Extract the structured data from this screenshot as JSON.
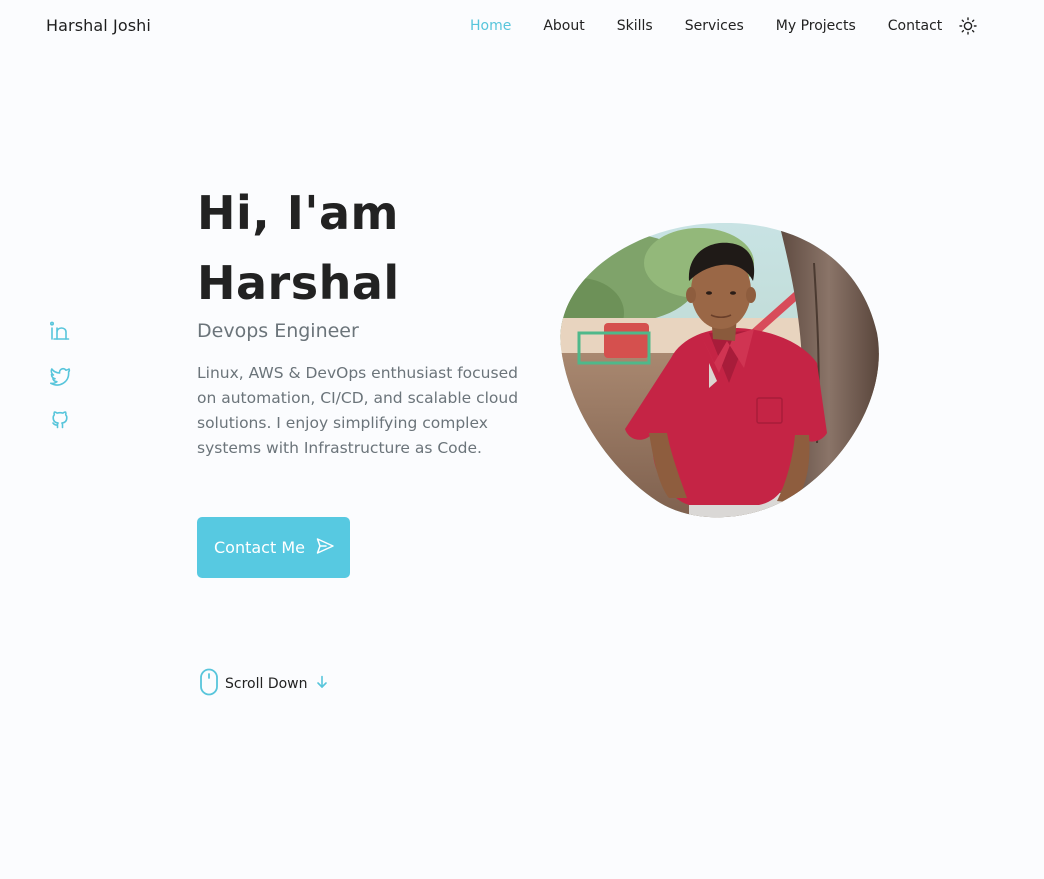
{
  "header": {
    "logo": "Harshal Joshi",
    "nav": {
      "home": "Home",
      "about": "About",
      "skills": "Skills",
      "services": "Services",
      "projects": "My Projects",
      "contact": "Contact"
    },
    "theme_icon": "sun-icon"
  },
  "social": {
    "icons": [
      "linkedin-icon",
      "twitter-icon",
      "github-icon"
    ]
  },
  "hero": {
    "greeting": "Hi, I'am",
    "name": "Harshal",
    "subtitle": "Devops Engineer",
    "description": "Linux, AWS & DevOps enthusiast focused on automation, CI/CD, and scalable cloud solutions. I enjoy simplifying complex systems with Infrastructure as Code.",
    "contact_button": "Contact Me",
    "contact_icon": "send-icon"
  },
  "scroll": {
    "label": "Scroll Down",
    "mouse_icon": "mouse-icon",
    "arrow_icon": "arrow-down-icon"
  },
  "colors": {
    "accent": "#57c5db",
    "button": "#57c9e1",
    "text": "#222222",
    "muted": "#6b747a",
    "background": "#fbfcfe"
  }
}
